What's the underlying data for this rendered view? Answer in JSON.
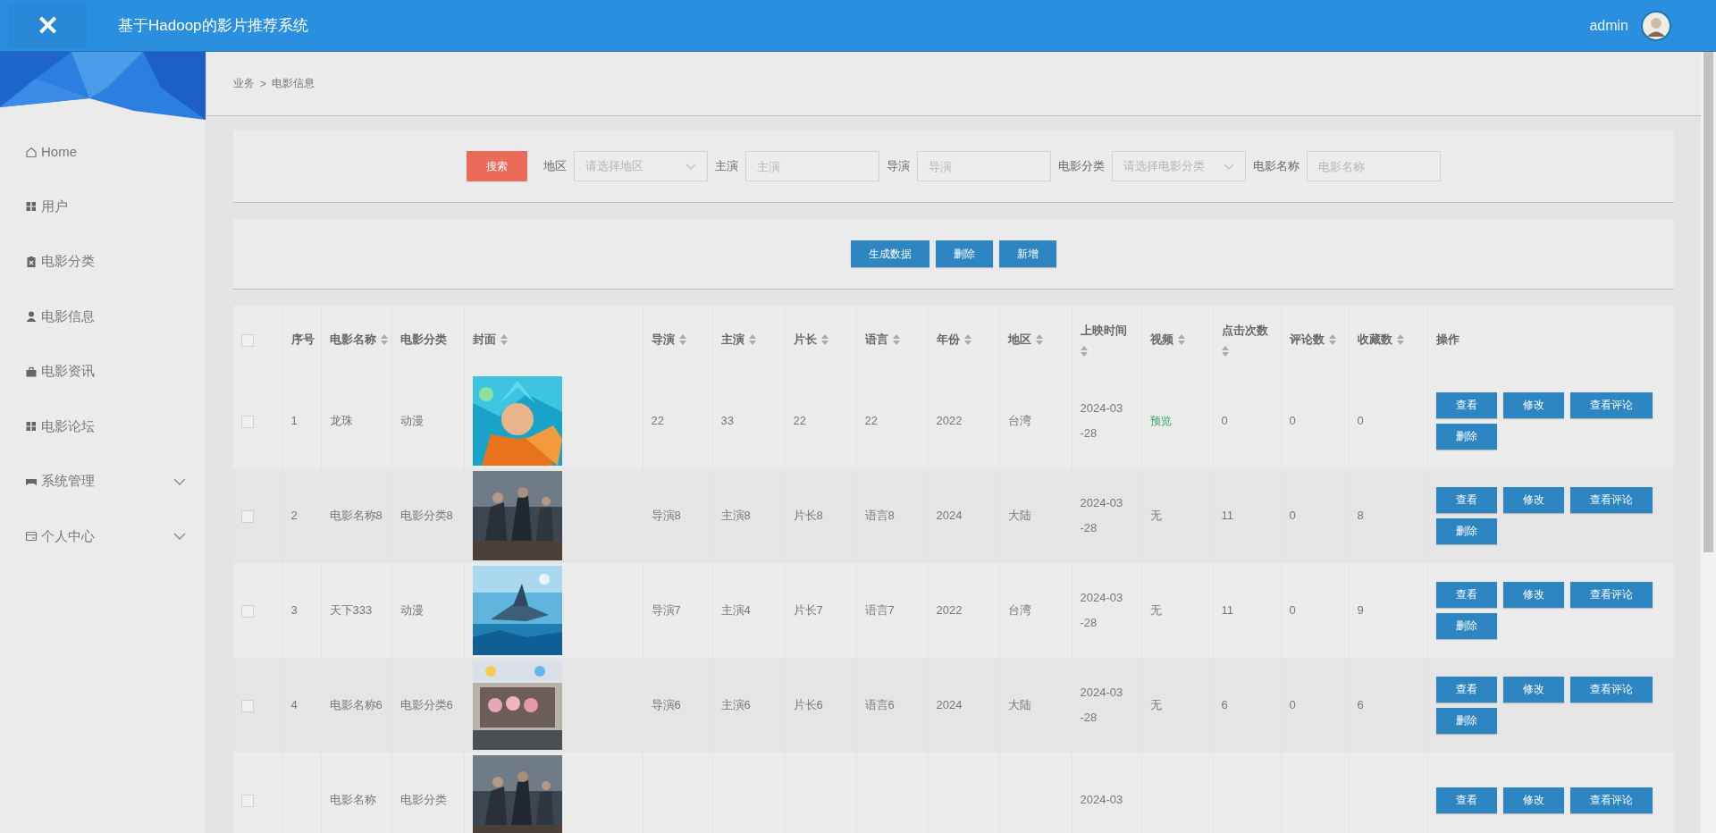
{
  "header": {
    "title": "基于Hadoop的影片推荐系统",
    "close_icon_text": "✕",
    "user": "admin"
  },
  "sidebar": {
    "items": [
      {
        "label": "Home",
        "expandable": false
      },
      {
        "label": "用户",
        "expandable": false
      },
      {
        "label": "电影分类",
        "expandable": false
      },
      {
        "label": "电影信息",
        "expandable": false
      },
      {
        "label": "电影资讯",
        "expandable": false
      },
      {
        "label": "电影论坛",
        "expandable": false
      },
      {
        "label": "系统管理",
        "expandable": true
      },
      {
        "label": "个人中心",
        "expandable": true
      }
    ]
  },
  "breadcrumb": [
    "业务",
    ">",
    "电影信息"
  ],
  "search": {
    "button": "搜索",
    "fields": [
      {
        "label": "地区",
        "kind": "select",
        "placeholder": "请选择地区"
      },
      {
        "label": "主演",
        "kind": "input",
        "placeholder": "主演"
      },
      {
        "label": "导演",
        "kind": "input",
        "placeholder": "导演"
      },
      {
        "label": "电影分类",
        "kind": "select",
        "placeholder": "请选择电影分类"
      },
      {
        "label": "电影名称",
        "kind": "input",
        "placeholder": "电影名称"
      }
    ]
  },
  "actions": [
    "生成数据",
    "删除",
    "新增"
  ],
  "table": {
    "columns": [
      {
        "kind": "checkbox",
        "checked": false
      },
      {
        "label": "序号",
        "sortable": false
      },
      {
        "label": "电影名称",
        "sortable": true
      },
      {
        "label": "电影分类",
        "sortable": false
      },
      {
        "label": "封面",
        "sortable": true
      },
      {
        "label": "导演",
        "sortable": true
      },
      {
        "label": "主演",
        "sortable": true
      },
      {
        "label": "片长",
        "sortable": true
      },
      {
        "label": "语言",
        "sortable": true
      },
      {
        "label": "年份",
        "sortable": true
      },
      {
        "label": "地区",
        "sortable": true
      },
      {
        "label": "上映时间",
        "sortable": true
      },
      {
        "label": "视频",
        "sortable": true
      },
      {
        "label": "点击次数",
        "sortable": true
      },
      {
        "label": "评论数",
        "sortable": true
      },
      {
        "label": "收藏数",
        "sortable": true
      },
      {
        "label": "操作",
        "sortable": false
      }
    ],
    "rows": [
      {
        "checked": false,
        "index": "1",
        "name": "龙珠",
        "category": "动漫",
        "cover": {
          "kind": "picture"
        },
        "director": "22",
        "actor": "33",
        "length": "22",
        "language": "22",
        "year": "2022",
        "region": "台湾",
        "release": "2024-03-28",
        "video": {
          "text": "预览",
          "kind": "link"
        },
        "clicks": "0",
        "comments": "0",
        "favorites": "0",
        "buttons": [
          "查看",
          "修改",
          "查看评论",
          "删除"
        ]
      },
      {
        "checked": false,
        "index": "2",
        "name": "电影名称8",
        "category": "电影分类8",
        "cover": {
          "kind": "picture"
        },
        "director": "导演8",
        "actor": "主演8",
        "length": "片长8",
        "language": "语言8",
        "year": "2024",
        "region": "大陆",
        "release": "2024-03-28",
        "video": {
          "text": "无",
          "kind": "text"
        },
        "clicks": "11",
        "comments": "0",
        "favorites": "8",
        "buttons": [
          "查看",
          "修改",
          "查看评论",
          "删除"
        ]
      },
      {
        "checked": false,
        "index": "3",
        "name": "天下333",
        "category": "动漫",
        "cover": {
          "kind": "picture"
        },
        "director": "导演7",
        "actor": "主演4",
        "length": "片长7",
        "language": "语言7",
        "year": "2022",
        "region": "台湾",
        "release": "2024-03-28",
        "video": {
          "text": "无",
          "kind": "text"
        },
        "clicks": "11",
        "comments": "0",
        "favorites": "9",
        "buttons": [
          "查看",
          "修改",
          "查看评论",
          "删除"
        ]
      },
      {
        "checked": false,
        "index": "4",
        "name": "电影名称6",
        "category": "电影分类6",
        "cover": {
          "kind": "picture"
        },
        "director": "导演6",
        "actor": "主演6",
        "length": "片长6",
        "language": "语言6",
        "year": "2024",
        "region": "大陆",
        "release": "2024-03-28",
        "video": {
          "text": "无",
          "kind": "text"
        },
        "clicks": "6",
        "comments": "0",
        "favorites": "6",
        "buttons": [
          "查看",
          "修改",
          "查看评论",
          "删除"
        ]
      },
      {
        "checked": false,
        "name": "电影名称",
        "category": "电影分类",
        "cover": {
          "kind": "picture"
        },
        "release": "2024-03",
        "buttons": [
          "查看",
          "修改",
          "查看评论"
        ]
      }
    ]
  }
}
